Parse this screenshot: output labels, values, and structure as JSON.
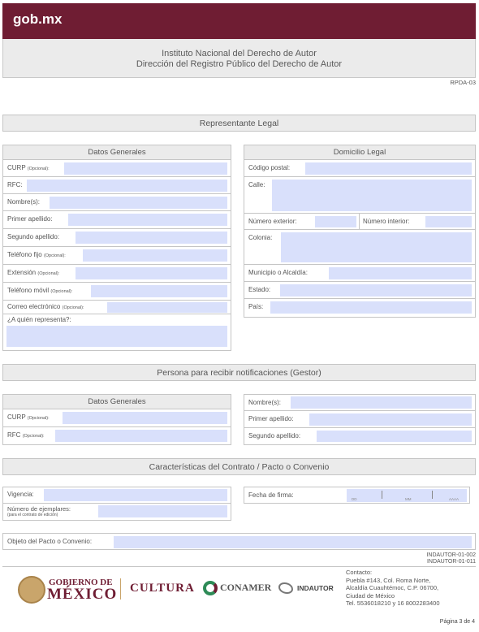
{
  "header": {
    "logo": "gob.mx"
  },
  "institution": {
    "line1": "Instituto Nacional del Derecho de Autor",
    "line2": "Dirección del Registro Público del Derecho de Autor"
  },
  "form_code": "RPDA-03",
  "sections": {
    "representante": "Representante Legal",
    "datos_generales": "Datos Generales",
    "domicilio": "Domicilio Legal",
    "gestor": "Persona para recibir notificaciones (Gestor)",
    "gestor_datos": "Datos Generales",
    "contrato": "Características del Contrato / Pacto o Convenio"
  },
  "rep_fields": {
    "curp": "CURP",
    "curp_opt": "(Opcional):",
    "rfc": "RFC:",
    "nombre": "Nombre(s):",
    "primer": "Primer apellido:",
    "segundo": "Segundo apellido:",
    "tel": "Teléfono fijo",
    "tel_opt": "(Opcional):",
    "ext": "Extensión",
    "ext_opt": "(Opcional):",
    "movil": "Teléfono móvil",
    "movil_opt": "(Opcional):",
    "correo": "Correo electrónico",
    "correo_opt": "(Opcional):",
    "quien": "¿A quién representa?:"
  },
  "dom_fields": {
    "cp": "Código postal:",
    "calle": "Calle:",
    "num_ext": "Número exterior:",
    "num_int": "Número interior:",
    "colonia": "Colonia:",
    "municipio": "Municipio o Alcaldía:",
    "estado": "Estado:",
    "pais": "País:"
  },
  "gestor_fields": {
    "curp": "CURP",
    "curp_opt": "(Opcional):",
    "rfc": "RFC",
    "rfc_opt": "(Opcional):",
    "nombre": "Nombre(s):",
    "primer": "Primer apellido:",
    "segundo": "Segundo apellido:"
  },
  "contrato_fields": {
    "vigencia": "Vigencia:",
    "ejemplares": "Número de ejemplares:",
    "ejemplares_note": "(para el contrato de edición)",
    "fecha": "Fecha de firma:",
    "dd": "DD",
    "mm": "MM",
    "aaaa": "AAAA",
    "objeto": "Objeto del Pacto o Convenio:"
  },
  "footer": {
    "code1": "INDAUTOR-01-002",
    "code2": "INDAUTOR-01-011",
    "gob_line1": "GOBIERNO DE",
    "gob_line2": "MÉXICO",
    "cultura": "CULTURA",
    "conamer": "CONAMER",
    "indautor": "INDAUTOR",
    "contact": [
      "Contacto:",
      "Puebla #143, Col. Roma Norte,",
      "Alcaldía Cuauhtémoc, C.P. 06700,",
      "Ciudad de México",
      "Tel. 5536018210 y 16  8002283400"
    ],
    "page": "Página 3 de 4"
  },
  "colors": {
    "header": "#6f1d33",
    "field_fill": "#d9e0fb",
    "bar": "#ebebeb"
  }
}
